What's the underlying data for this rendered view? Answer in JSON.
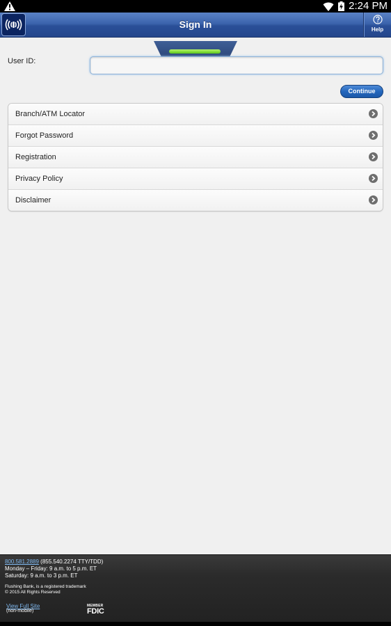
{
  "status_bar": {
    "time": "2:24 PM"
  },
  "header": {
    "title": "Sign In",
    "help_label": "Help",
    "logo_icon": "bank-logo-icon",
    "background_color": "#3c64ad"
  },
  "form": {
    "user_id_label": "User ID:",
    "user_id_value": "",
    "user_id_placeholder": "",
    "continue_label": "Continue"
  },
  "menu": {
    "items": [
      {
        "label": "Branch/ATM Locator"
      },
      {
        "label": "Forgot Password"
      },
      {
        "label": "Registration"
      },
      {
        "label": "Privacy Policy"
      },
      {
        "label": "Disclaimer"
      }
    ]
  },
  "footer": {
    "phone": "800.581.2889",
    "tty": " (855.540.2274 TTY/TDD)",
    "hours_weekday": "Monday – Friday: 9 a.m. to 5 p.m. ET",
    "hours_saturday": "Saturday: 9 a.m. to 3 p.m. ET",
    "trademark": "Flushing Bank, is a registered trademark",
    "copyright": "© 2015 All Rights Reserved",
    "full_site_label": "View Full Site",
    "full_site_sub": "(non-mobile)",
    "fdic_member": "MEMBER",
    "fdic_name": "FDIC"
  }
}
